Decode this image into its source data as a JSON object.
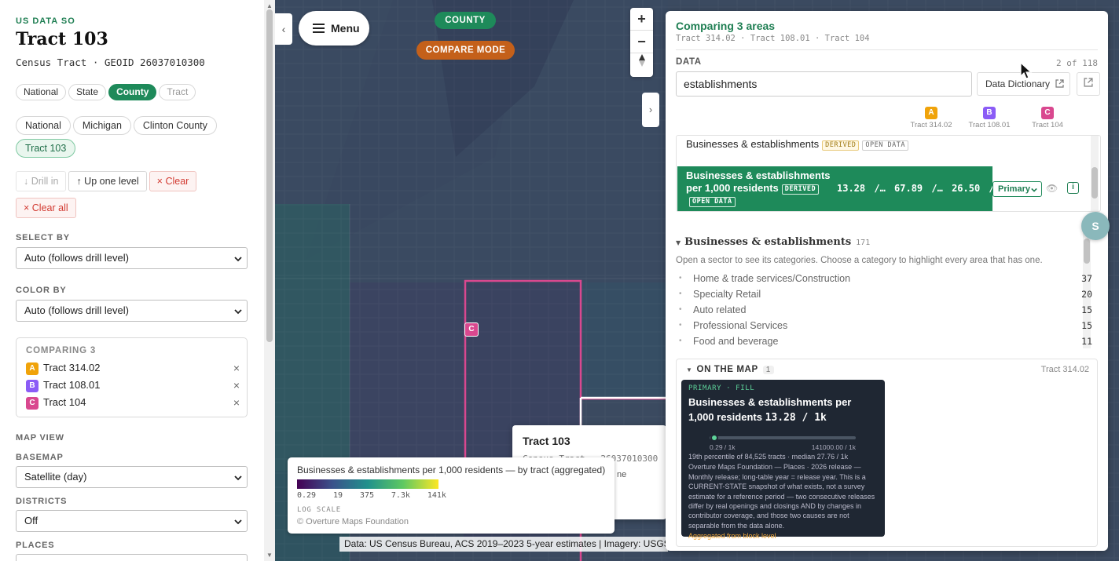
{
  "sidebar": {
    "kicker": "US DATA SO",
    "title": "Tract 103",
    "subtitle": "Census Tract · GEOID 26037010300",
    "levels": [
      "National",
      "State",
      "County",
      "Tract"
    ],
    "active_level": "County",
    "breadcrumbs": [
      "National",
      "Michigan",
      "Clinton County",
      "Tract 103"
    ],
    "actions": {
      "drill_in": "↓ Drill in",
      "up_one": "↑ Up one level",
      "clear": "× Clear",
      "clear_all": "× Clear all"
    },
    "select_by": {
      "label": "SELECT BY",
      "value": "Auto (follows drill level)"
    },
    "color_by": {
      "label": "COLOR BY",
      "value": "Auto (follows drill level)"
    },
    "comparing": {
      "header": "COMPARING 3",
      "items": [
        {
          "badge": "A",
          "label": "Tract 314.02",
          "color": "#f0a30a"
        },
        {
          "badge": "B",
          "label": "Tract 108.01",
          "color": "#8b5cf6"
        },
        {
          "badge": "C",
          "label": "Tract 104",
          "color": "#d9488f"
        }
      ]
    },
    "map_view": "MAP VIEW",
    "basemap": {
      "label": "BASEMAP",
      "value": "Satellite (day)"
    },
    "districts": {
      "label": "DISTRICTS",
      "value": "Off"
    },
    "places": {
      "label": "PLACES"
    }
  },
  "map": {
    "menu_label": "Menu",
    "level_pill": "COUNTY",
    "mode_pill": "COMPARE MODE",
    "marker_c": "C",
    "popup": {
      "title": "Tract 103",
      "geoid": "Census Tract · 26037010300",
      "note": "ne"
    },
    "legend": {
      "title": "Businesses & establishments per 1,000 residents — by tract (aggregated)",
      "ticks": [
        "0.29",
        "19",
        "375",
        "7.3k",
        "141k"
      ],
      "scale": "LOG SCALE",
      "source": "© Overture Maps Foundation"
    },
    "attribution": "Data: US Census Bureau, ACS 2019–2023 5-year estimates | Imagery: USGS"
  },
  "panel": {
    "title": "Comparing 3 areas",
    "subtitle": "Tract 314.02 · Tract 108.01 · Tract 104",
    "data_label": "DATA",
    "count": "2 of 118",
    "search_value": "establishments",
    "dictionary_label": "Data Dictionary",
    "columns": [
      {
        "badge": "A",
        "label": "Tract 314.02",
        "color": "#f0a30a"
      },
      {
        "badge": "B",
        "label": "Tract 108.01",
        "color": "#8b5cf6"
      },
      {
        "badge": "C",
        "label": "Tract 104",
        "color": "#d9488f"
      }
    ],
    "result1": {
      "name": "Businesses & establishments",
      "tags": [
        "DERIVED",
        "OPEN DATA"
      ]
    },
    "result2": {
      "name": "Businesses & establishments per 1,000 residents",
      "tags": [
        "DERIVED",
        "OPEN DATA"
      ],
      "values": [
        "13.28 /…",
        "67.89 /…",
        "26.50 /…"
      ],
      "role": "Primary"
    },
    "avatar": "S",
    "sector": {
      "title": "Businesses & establishments",
      "count": "171",
      "desc": "Open a sector to see its categories. Choose a category to highlight every area that has one.",
      "categories": [
        {
          "label": "Home & trade services/Construction",
          "n": "37"
        },
        {
          "label": "Specialty Retail",
          "n": "20"
        },
        {
          "label": "Auto related",
          "n": "15"
        },
        {
          "label": "Professional Services",
          "n": "15"
        },
        {
          "label": "Food and beverage",
          "n": "11"
        }
      ]
    },
    "on_map": {
      "title": "ON THE MAP",
      "count": "1",
      "tract": "Tract 314.02",
      "card": {
        "kicker": "PRIMARY · FILL",
        "title": "Businesses & establishments per 1,000 residents",
        "value": "13.28 / 1k",
        "min": "0.29 / 1k",
        "max": "141000.00 / 1k",
        "percentile": 0.0,
        "meta": "19th percentile of 84,525 tracts · median 27.76 / 1k",
        "desc": "Overture Maps Foundation — Places · 2026 release — Monthly release; long-table year = release year. This is a CURRENT-STATE snapshot of what exists, not a survey estimate for a reference period — two consecutive releases differ by real openings and closings AND by changes in contributor coverage, and those two causes are not separable from the data alone.",
        "aggregated": "Aggregated from block level"
      }
    }
  }
}
